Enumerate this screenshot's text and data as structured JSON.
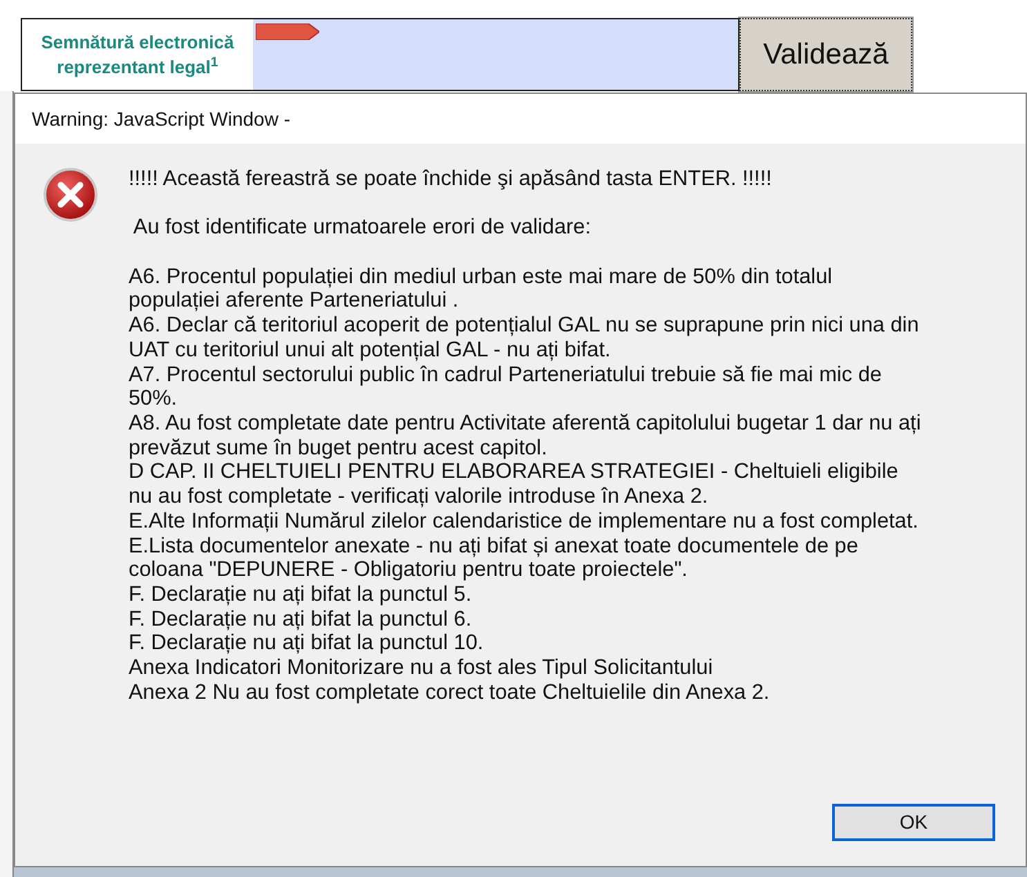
{
  "form": {
    "label": "Semnătură electronică reprezentant legal$^{1}$",
    "validate_button": "Validează"
  },
  "dialog": {
    "title": "Warning: JavaScript Window -",
    "intro": "!!!!! Această fereastră se poate închide şi apăsând tasta ENTER. !!!!!",
    "heading": " Au fost identificate urmatoarele erori de validare:",
    "errors": [
      "A6. Procentul populației din mediul urban este mai mare de 50% din totalul populației aferente Parteneriatului .",
      "A6. Declar că teritoriul acoperit de potențialul GAL nu se suprapune prin nici una din UAT cu teritoriul unui alt potențial GAL - nu ați bifat.",
      "A7. Procentul sectorului public în cadrul Parteneriatului trebuie să fie mai mic de 50%.",
      "A8. Au fost completate date pentru Activitate aferentă capitolului bugetar 1 dar nu ați prevăzut sume în buget pentru acest capitol.",
      "D CAP. II CHELTUIELI PENTRU ELABORAREA STRATEGIEI  - Cheltuieli eligibile nu au fost completate - verificați valorile introduse în Anexa 2.",
      "E.Alte Informații Numărul zilelor calendaristice de implementare nu a fost completat.",
      "E.Lista documentelor anexate - nu ați bifat și anexat toate documentele de pe coloana \"DEPUNERE - Obligatoriu pentru toate proiectele\".",
      "F. Declarație nu ați bifat la punctul 5.",
      "F. Declarație nu ați bifat la punctul 6.",
      "F. Declarație nu ați bifat la punctul 10.",
      "Anexa Indicatori Monitorizare nu a fost ales Tipul Solicitantului",
      "Anexa 2 Nu au fost completate corect toate Cheltuielile din Anexa 2."
    ],
    "ok_button": "OK"
  }
}
